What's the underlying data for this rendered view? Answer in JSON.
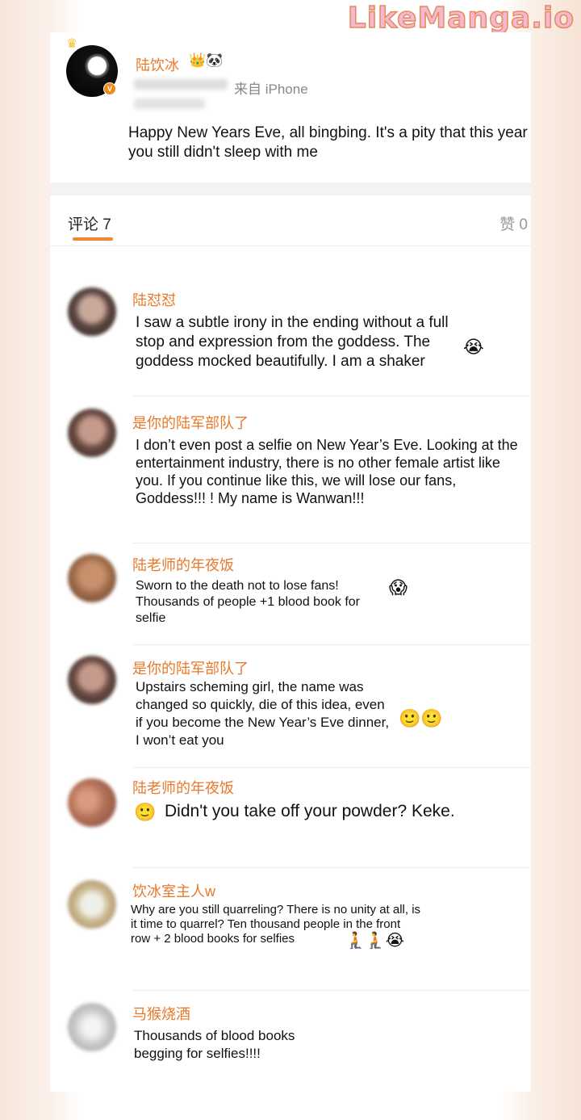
{
  "watermark": "LikeManga.io",
  "post": {
    "user_name": "陆饮冰",
    "badges": "👑🐼",
    "source": "来自 iPhone",
    "text": "Happy New Years Eve, all bingbing.  It's a pity that this year you still didn't sleep with me"
  },
  "tabs": {
    "comments": "评论 7",
    "likes": "赞 0"
  },
  "comments": [
    {
      "name": "陆怼怼",
      "text": "I saw a subtle irony in the ending without a full stop and expression from the goddess. The goddess mocked beautifully. I am a shaker",
      "emoji": "😭"
    },
    {
      "name": "是你的陆军部队了",
      "text": "I don’t even post a selfie on New Year’s Eve. Looking at the entertainment industry, there is no other female artist like you. If you continue like this, we will lose our fans, Goddess!!!  ! My name is Wanwan!!!",
      "emoji": ""
    },
    {
      "name": "陆老师的年夜饭",
      "text": "Sworn to the death not to lose fans! Thousands of people +1 blood book for selfie",
      "emoji": "😱"
    },
    {
      "name": "是你的陆军部队了",
      "text": "Upstairs scheming girl, the name was changed so quickly, die of this idea, even if you become the New Year’s Eve dinner, I won’t eat you",
      "emoji": "🙂🙂"
    },
    {
      "name": "陆老师的年夜饭",
      "text": "Didn't you take off your powder? Keke.",
      "emoji": "🙂"
    },
    {
      "name": "饮冰室主人w",
      "text": "Why are you still quarreling? There is no unity at all, is it time to quarrel? Ten thousand people in the front row + 2 blood books for selfies",
      "emoji": "🧎🧎😭"
    },
    {
      "name": "马猴烧酒",
      "text": "Thousands of blood books begging for selfies!!!!",
      "emoji": ""
    }
  ],
  "colors": {
    "accent": "#e8792a",
    "divider": "#eeeeee"
  }
}
